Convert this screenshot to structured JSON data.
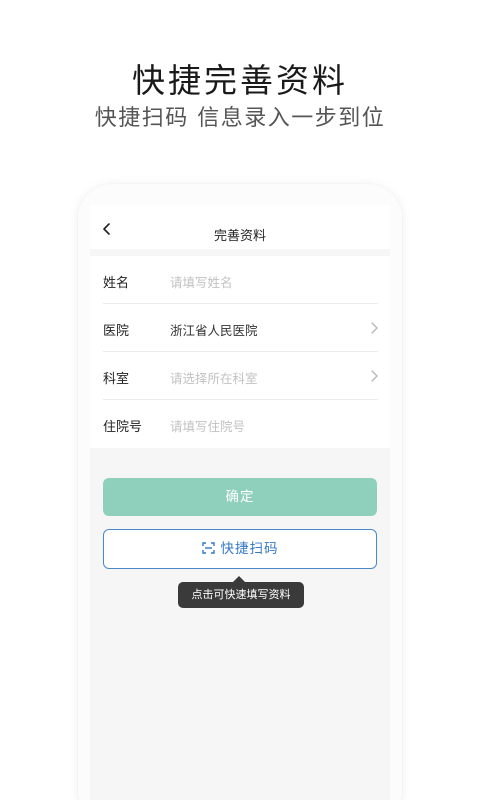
{
  "promo": {
    "title": "快捷完善资料",
    "subtitle": "快捷扫码 信息录入一步到位"
  },
  "navbar": {
    "title": "完善资料",
    "back_icon": "chevron-left-icon"
  },
  "form": {
    "fields": [
      {
        "label": "姓名",
        "value": "",
        "placeholder": "请填写姓名",
        "has_chevron": false
      },
      {
        "label": "医院",
        "value": "浙江省人民医院",
        "placeholder": "",
        "has_chevron": true
      },
      {
        "label": "科室",
        "value": "",
        "placeholder": "请选择所在科室",
        "has_chevron": true
      },
      {
        "label": "住院号",
        "value": "",
        "placeholder": "请填写住院号",
        "has_chevron": false
      }
    ]
  },
  "actions": {
    "confirm_label": "确定",
    "scan_label": "快捷扫码",
    "scan_icon": "scan-icon"
  },
  "tooltip": {
    "text": "点击可快速填写资料"
  },
  "colors": {
    "confirm_bg": "#8fd0bd",
    "scan_accent": "#3478c6",
    "tooltip_bg": "#3a3a3a"
  }
}
